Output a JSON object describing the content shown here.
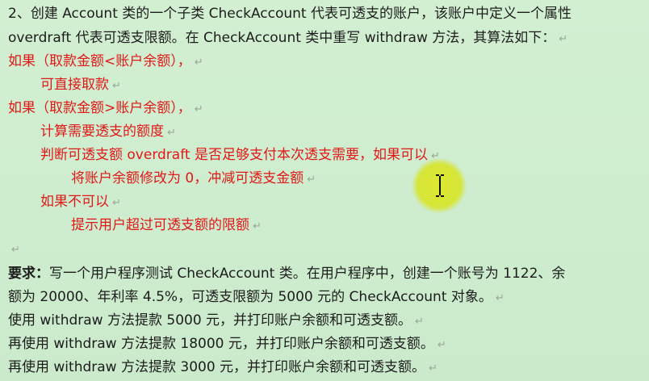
{
  "lines": [
    {
      "text": "2、创建 Account 类的一个子类 CheckAccount 代表可透支的账户，该账户中定义一个属性",
      "mark": false
    },
    {
      "text": "overdraft 代表可透支限额。在 CheckAccount 类中重写 withdraw 方法，其算法如下：",
      "mark": true
    },
    {
      "text": "如果（取款金额<账户余额），",
      "mark": true
    },
    {
      "text": "可直接取款",
      "mark": true
    },
    {
      "text": "如果（取款金额>账户余额），",
      "mark": true
    },
    {
      "text": "计算需要透支的额度",
      "mark": true
    },
    {
      "text": "判断可透支额 overdraft 是否足够支付本次透支需要，如果可以",
      "mark": true
    },
    {
      "text": "将账户余额修改为 0，冲减可透支金额",
      "mark": true
    },
    {
      "text": "如果不可以",
      "mark": true
    },
    {
      "text": "提示用户超过可透支额的限额",
      "mark": true
    },
    {
      "text": "",
      "mark": true
    },
    {
      "prefix": "要求：",
      "text": "写一个用户程序测试 CheckAccount 类。在用户程序中，创建一个账号为 1122、余",
      "mark": false
    },
    {
      "text": "额为 20000、年利率 4.5%，可透支限额为 5000 元的 CheckAccount 对象。",
      "mark": true
    },
    {
      "text": "使用 withdraw 方法提款 5000 元，并打印账户余额和可透支额。",
      "mark": true
    },
    {
      "text": "再使用 withdraw 方法提款 18000 元，并打印账户余额和可透支额。",
      "mark": true
    },
    {
      "text": "再使用 withdraw 方法提款 3000 元，并打印账户余额和可透支额。",
      "mark": true
    }
  ],
  "paragraph_mark": "↵",
  "colors": {
    "background": "#cdeccd",
    "text": "#1c1c1c",
    "highlight": "#e01818",
    "cursor_halo": "#dde828"
  },
  "cursor_icon": "text-cursor-icon"
}
